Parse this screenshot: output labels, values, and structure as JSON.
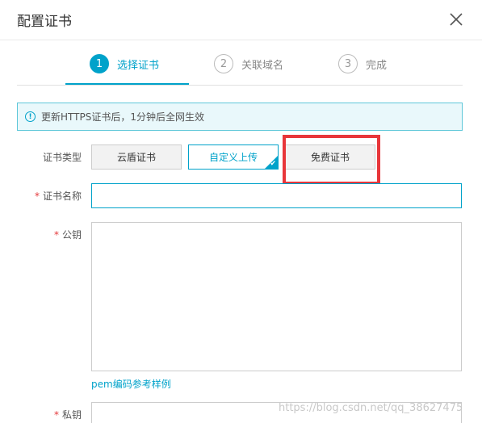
{
  "dialog": {
    "title": "配置证书",
    "close_icon": "close-icon"
  },
  "steps": [
    {
      "number": "1",
      "label": "选择证书",
      "active": true
    },
    {
      "number": "2",
      "label": "关联域名",
      "active": false
    },
    {
      "number": "3",
      "label": "完成",
      "active": false
    }
  ],
  "notice": {
    "icon": "info-icon",
    "text": "更新HTTPS证书后，1分钟后全网生效"
  },
  "form": {
    "cert_type_label": "证书类型",
    "cert_types": [
      "云盾证书",
      "自定义上传",
      "免费证书"
    ],
    "selected_cert_type": "自定义上传",
    "cert_name_label": "证书名称",
    "cert_name_value": "",
    "public_key_label": "公钥",
    "public_key_value": "",
    "pem_link": "pem编码参考样例",
    "private_key_label": "私钥",
    "private_key_value": "",
    "required_mark": "*"
  },
  "watermark": "https://blog.csdn.net/qq_38627475",
  "colors": {
    "accent": "#00a2ca",
    "highlight": "#e8363a",
    "required": "#e4393c"
  }
}
